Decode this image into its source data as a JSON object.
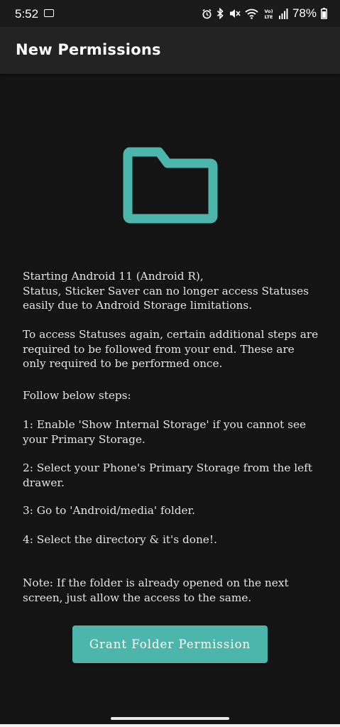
{
  "status_bar": {
    "time": "5:52",
    "battery": "78%",
    "icons": [
      "screenshot-icon",
      "alarm-icon",
      "bluetooth-icon",
      "mute-icon",
      "wifi-icon",
      "volte-icon",
      "signal-icon",
      "battery-icon"
    ]
  },
  "app_bar": {
    "title": "New Permissions"
  },
  "content": {
    "icon": "folder-icon",
    "accent_color": "#4db6ac",
    "paragraphs": [
      "Starting Android 11 (Android R),\nStatus, Sticker Saver can no longer access Statuses easily due to Android Storage limitations.",
      "To access Statuses again, certain additional steps are required to be followed from your end. These are only required to be performed once.",
      "Follow below steps:",
      "1: Enable 'Show Internal Storage' if you cannot see your Primary Storage.",
      "2: Select your Phone's Primary Storage from the left drawer.",
      "3: Go to 'Android/media' folder.",
      "4: Select the directory & it's done!.",
      "Note: If the folder is already opened on the next screen, just allow the access to the same."
    ],
    "button_label": "Grant Folder Permission"
  }
}
